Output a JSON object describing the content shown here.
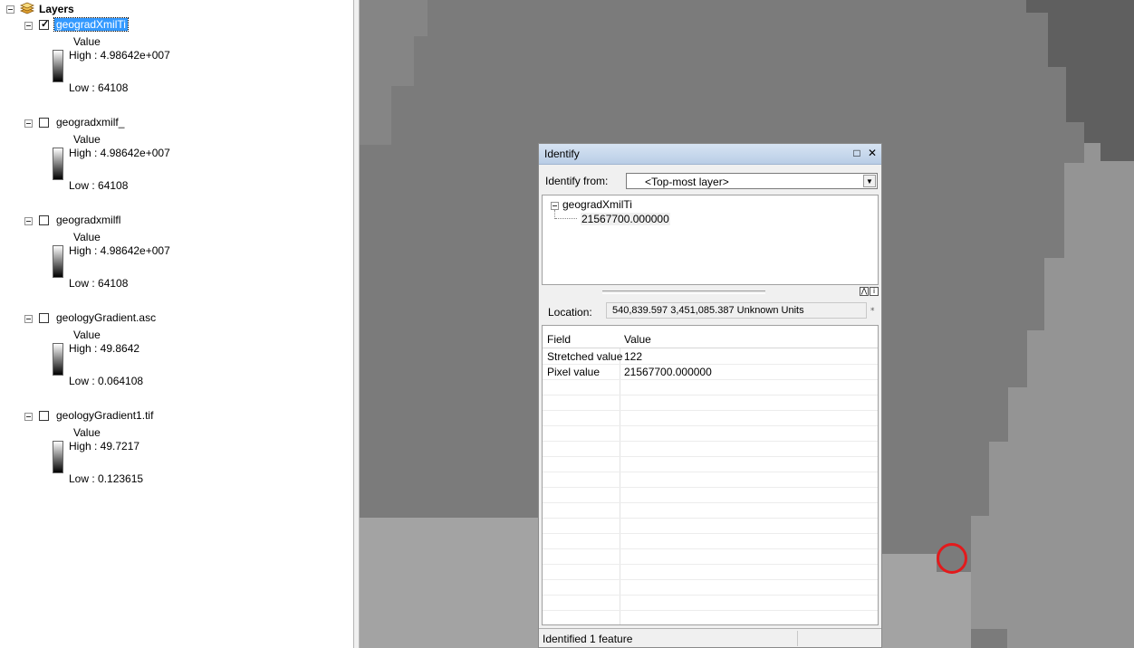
{
  "toc": {
    "root_label": "Layers",
    "layers": [
      {
        "name": "geogradXmilTi",
        "checked": true,
        "selected": true,
        "value_label": "Value",
        "high": "High : 4.98642e+007",
        "low": "Low : 64108"
      },
      {
        "name": "geogradxmilf_",
        "checked": false,
        "selected": false,
        "value_label": "Value",
        "high": "High : 4.98642e+007",
        "low": "Low : 64108"
      },
      {
        "name": "geogradxmilfl",
        "checked": false,
        "selected": false,
        "value_label": "Value",
        "high": "High : 4.98642e+007",
        "low": "Low : 64108"
      },
      {
        "name": "geologyGradient.asc",
        "checked": false,
        "selected": false,
        "value_label": "Value",
        "high": "High : 49.8642",
        "low": "Low : 0.064108"
      },
      {
        "name": "geologyGradient1.tif",
        "checked": false,
        "selected": false,
        "value_label": "Value",
        "high": "High : 49.7217",
        "low": "Low : 0.123615"
      }
    ]
  },
  "identify": {
    "title": "Identify",
    "from_label": "Identify from:",
    "from_value": "<Top-most layer>",
    "tree_layer": "geogradXmilTi",
    "tree_value": "21567700.000000",
    "location_label": "Location:",
    "location_value": "540,839.597  3,451,085.387 Unknown Units",
    "grid_headers": {
      "field": "Field",
      "value": "Value"
    },
    "rows": [
      {
        "field": "Stretched value",
        "value": "122"
      },
      {
        "field": "Pixel value",
        "value": "21567700.000000"
      }
    ],
    "status": "Identified 1 feature"
  },
  "colors": {
    "map_dark": "#5f5f5f",
    "map_mid": "#7b7b7b",
    "map_light": "#949494",
    "map_lighter": "#a3a3a3",
    "marker": "#e31a1c"
  }
}
